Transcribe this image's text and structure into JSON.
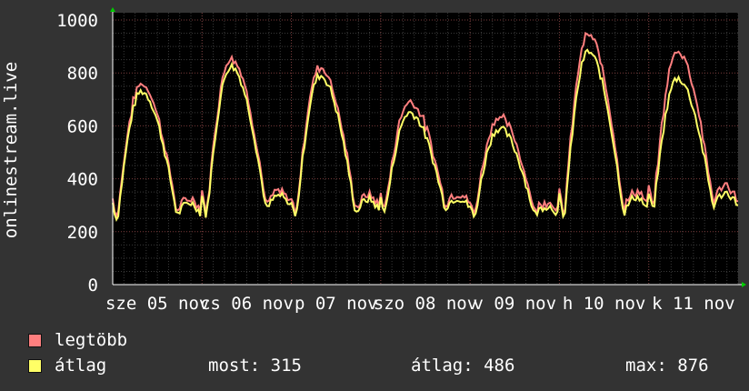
{
  "chart_data": {
    "type": "line",
    "ylabel": "onlinestream.live",
    "ylim": [
      0,
      1000
    ],
    "yticks": [
      0,
      200,
      400,
      600,
      800,
      1000
    ],
    "x_tick_labels": [
      "sze 05 nov",
      "cs 06 nov",
      "p 07 nov",
      "szo 08 nov",
      "v 09 nov",
      "h 10 nov",
      "k 11 nov"
    ],
    "daily_peaks": {
      "legtöbb": [
        745,
        845,
        810,
        680,
        620,
        930,
        870
      ],
      "átlag": [
        730,
        825,
        790,
        650,
        590,
        880,
        780
      ]
    },
    "daily_troughs": {
      "legtöbb": [
        240,
        260,
        245,
        275,
        250,
        240,
        275
      ],
      "átlag": [
        235,
        250,
        240,
        270,
        245,
        235,
        270
      ]
    },
    "grid": true,
    "colors": {
      "background": "#333333",
      "plot": "#000000",
      "legtöbb": "#ff7f7f",
      "átlag": "#ffff66"
    }
  },
  "legend": [
    {
      "label": "legtöbb",
      "color": "#ff7f7f"
    },
    {
      "label": "átlag",
      "color": "#ffff66"
    }
  ],
  "stats": {
    "now_label": "most:",
    "now_value": "315",
    "avg_label": "átlag:",
    "avg_value": "486",
    "max_label": "max:",
    "max_value": "876"
  }
}
